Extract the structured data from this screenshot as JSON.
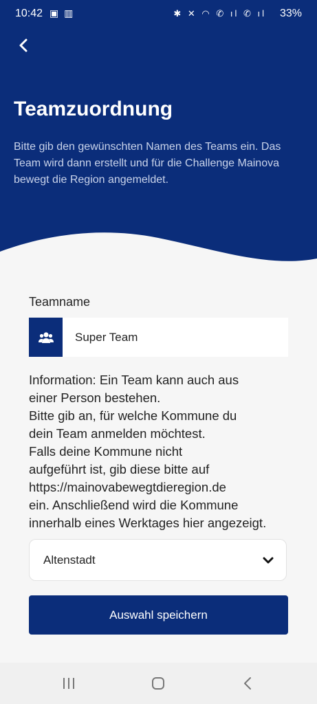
{
  "status_bar": {
    "time": "10:42",
    "left_icons": "▣ ▥",
    "right_icons": "✱ ✕ ◠ ✆ ıl ✆ ıl",
    "battery": "33%"
  },
  "header": {
    "back_icon": "chevron-left-icon",
    "title": "Teamzuordnung",
    "subtitle": "Bitte gib den gewünschten Namen des Teams ein. Das Team wird dann erstellt und für die Challenge Mainova bewegt die Region angemeldet.",
    "color": "#0b2d7a"
  },
  "form": {
    "team_label": "Teamname",
    "team_value": "Super Team",
    "team_icon": "users-icon",
    "info": "Information: Ein Team kann auch aus\neiner Person bestehen.\nBitte gib an, für welche Kommune du\ndein Team anmelden möchtest.\nFalls deine Kommune nicht\naufgeführt ist, gib diese bitte auf\nhttps://mainovabewegtdieregion.de\nein. Anschließend wird die Kommune\ninnerhalb eines Werktages hier angezeigt.",
    "kommune_selected": "Altenstadt",
    "save_label": "Auswahl speichern"
  },
  "nav": {
    "recent_icon": "recent-apps-icon",
    "home_icon": "home-icon",
    "back_icon": "back-icon"
  }
}
